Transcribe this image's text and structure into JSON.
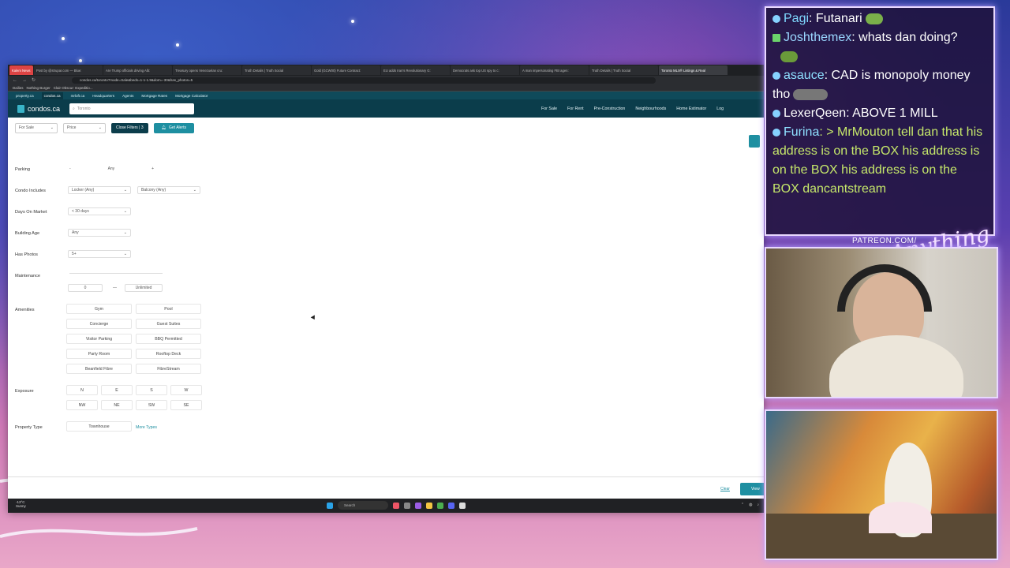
{
  "tabs": [
    "Kalem News",
    "Post by @strupar.com — Blue:",
    "Are Trump officials driving Alb:",
    "Treasury opens Venezuelan cru:",
    "Truth Details | Truth Social",
    "Gold (GCW00) Future Contract:",
    "EU adds Iran's Revolutionary G:",
    "Democrats ask top US spy to c:",
    "A man impersonating FBI agen:",
    "Truth Details | Truth Social",
    "Toronto MLS® Listings & Real"
  ],
  "url": "condos.ca/toronto?mode=Sale&beds=1-1-1.9&dom=-30&has_photos=5",
  "bookmarks": [
    "Dailies",
    "Nothing Burger",
    "Clair Obscur: Expeditio..."
  ],
  "subnav": [
    "property.ca",
    "condos.ca",
    "mrloft.ca",
    "Headquarters",
    "Agents",
    "Mortgage Rates",
    "Mortgage Calculator"
  ],
  "logo": "condos.ca",
  "search_value": "Toronto",
  "topnav": [
    "For Sale",
    "For Rent",
    "Pre-Construction",
    "Neighbourhoods",
    "Home Estimator",
    "Log"
  ],
  "filterbar": {
    "sale": "For Sale",
    "price": "Price",
    "close": "Close Filters | 3",
    "alerts": "Get Alerts"
  },
  "filters": {
    "parking": {
      "label": "Parking",
      "minus": "-",
      "value": "Any",
      "plus": "+"
    },
    "condo_includes": {
      "label": "Condo Includes",
      "locker": "Locker (Any)",
      "balcony": "Balcony (Any)"
    },
    "days_on_market": {
      "label": "Days On Market",
      "value": "< 30 days"
    },
    "building_age": {
      "label": "Building Age",
      "value": "Any"
    },
    "has_photos": {
      "label": "Has Photos",
      "value": "5+"
    },
    "maintenance": {
      "label": "Maintenance",
      "min": "0",
      "dash": "—",
      "max": "Unlimited"
    },
    "amenities": {
      "label": "Amenities",
      "items": [
        "Gym",
        "Pool",
        "Concierge",
        "Guest Suites",
        "Visitor Parking",
        "BBQ Permitted",
        "Party Room",
        "Rooftop Deck",
        "Beanfield Fibre",
        "FibreStream"
      ]
    },
    "exposure": {
      "label": "Exposure",
      "items": [
        "N",
        "E",
        "S",
        "W",
        "NW",
        "NE",
        "SW",
        "SE"
      ]
    },
    "property_type": {
      "label": "Property Type",
      "value": "Townhouse",
      "more": "More Types"
    }
  },
  "footer": {
    "clear": "Clear",
    "view": "View"
  },
  "taskbar": {
    "weather_temp": "-13°C",
    "weather_desc": "Sunny",
    "search": "Search"
  },
  "chat": [
    {
      "user": "Pagi",
      "text": ": Futanari"
    },
    {
      "user": "Joshthemex",
      "text": ": whats dan doing?"
    },
    {
      "user": "asauce",
      "text": ": CAD is monopoly money tho"
    },
    {
      "user": "LexerQeen",
      "text": ": ABOVE 1 MILL"
    },
    {
      "user": "Furina",
      "text": ": > MrMouton tell dan that his address is on the BOX his address is on the BOX his address is on the BOX dancantstream"
    }
  ],
  "patreon": "PATREON.COM/",
  "brand_script": "Anything Else",
  "colors": {
    "brand_dark": "#0b3d4b",
    "accent": "#1e8fa1",
    "chat_bg": "#1e123a"
  }
}
